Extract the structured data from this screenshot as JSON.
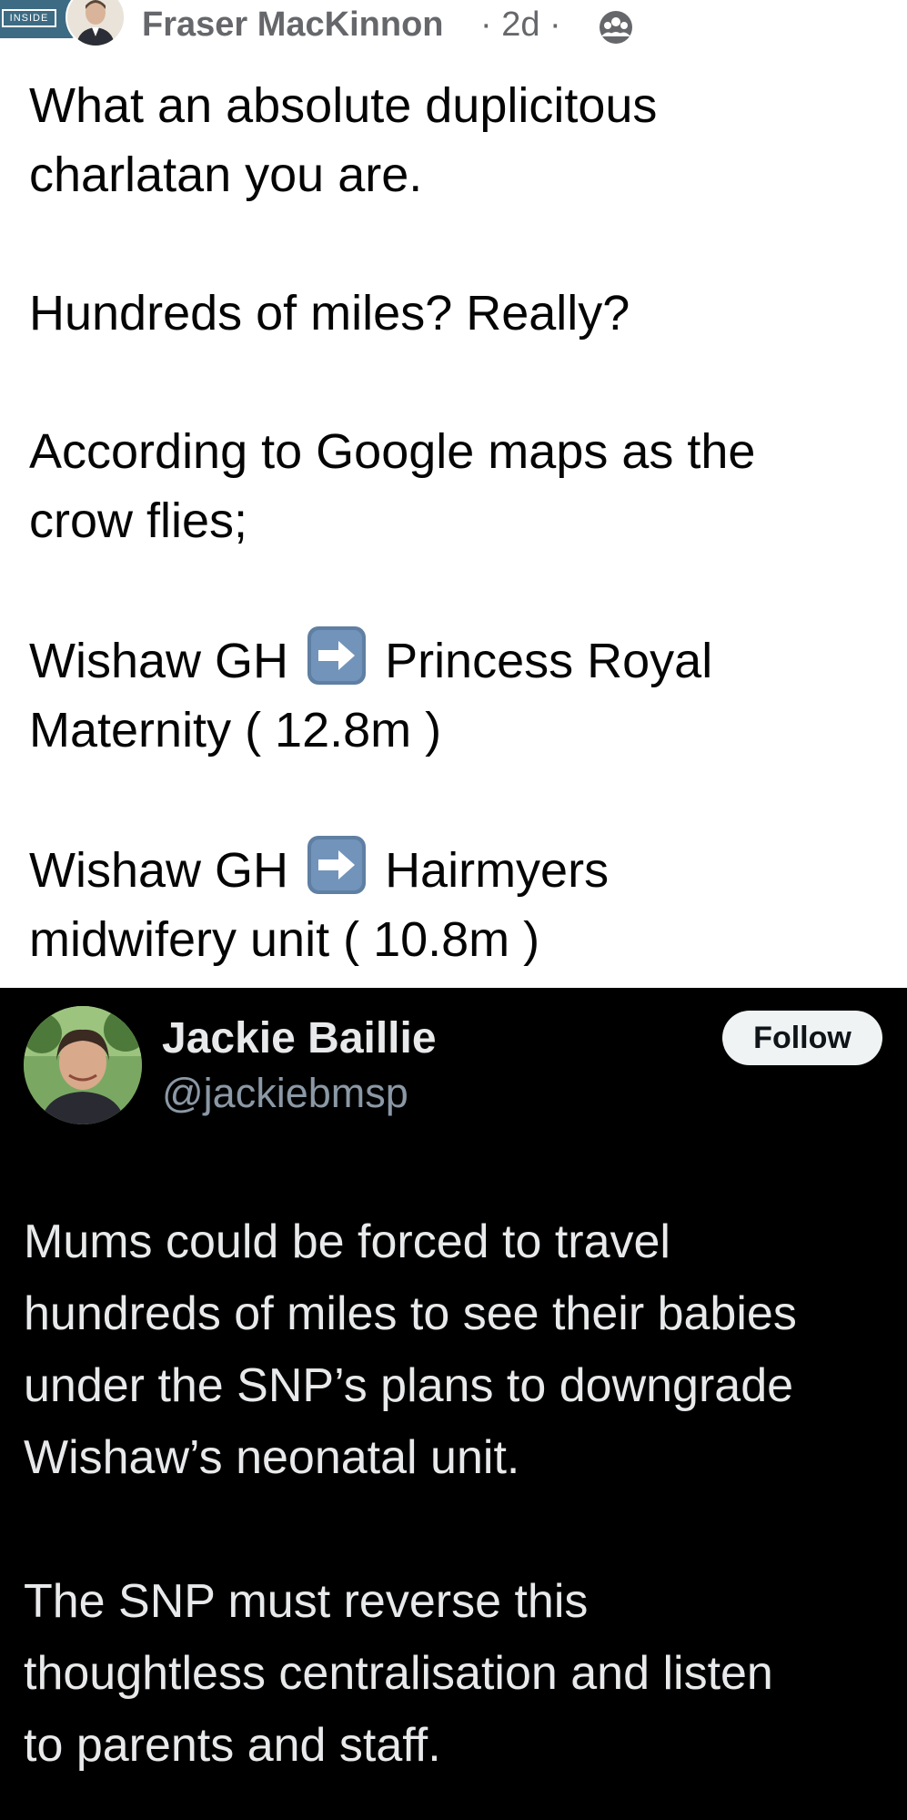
{
  "comment": {
    "author": "Fraser MacKinnon",
    "meta": "· 2d ·",
    "thumbnail_text": "INSIDE",
    "audience_icon": "friends-group-icon",
    "paragraphs": [
      [
        "What an absolute duplicitous",
        "charlatan you are."
      ],
      [
        "Hundreds of miles? Really?"
      ],
      [
        "According to Google maps as the",
        "crow flies;"
      ]
    ],
    "routes": [
      {
        "from": "Wishaw GH",
        "icon": "right-arrow-emoji-icon",
        "to_line1": "Princess Royal",
        "to_line2": "Maternity ( 12.8m )"
      },
      {
        "from": "Wishaw GH",
        "icon": "right-arrow-emoji-icon",
        "to_line1": "Hairmyers",
        "to_line2": "midwifery unit ( 10.8m )"
      }
    ]
  },
  "tweet": {
    "name": "Jackie Baillie",
    "handle": "@jackiebmsp",
    "follow_label": "Follow",
    "paragraphs": [
      [
        "Mums could be forced to travel",
        "hundreds of miles to see their babies",
        "under the SNP’s plans to downgrade",
        "Wishaw’s neonatal unit."
      ],
      [
        "The SNP must reverse this",
        "thoughtless centralisation and listen",
        "to parents and staff."
      ]
    ]
  },
  "colors": {
    "comment_bg": "#ffffff",
    "comment_text": "#050505",
    "comment_meta": "#65676b",
    "tweet_bg": "#000000",
    "tweet_text": "#e7e9ea",
    "tweet_handle": "#8b98a5",
    "follow_bg": "#eff3f4",
    "arrow_emoji": "#5f7fa3"
  }
}
